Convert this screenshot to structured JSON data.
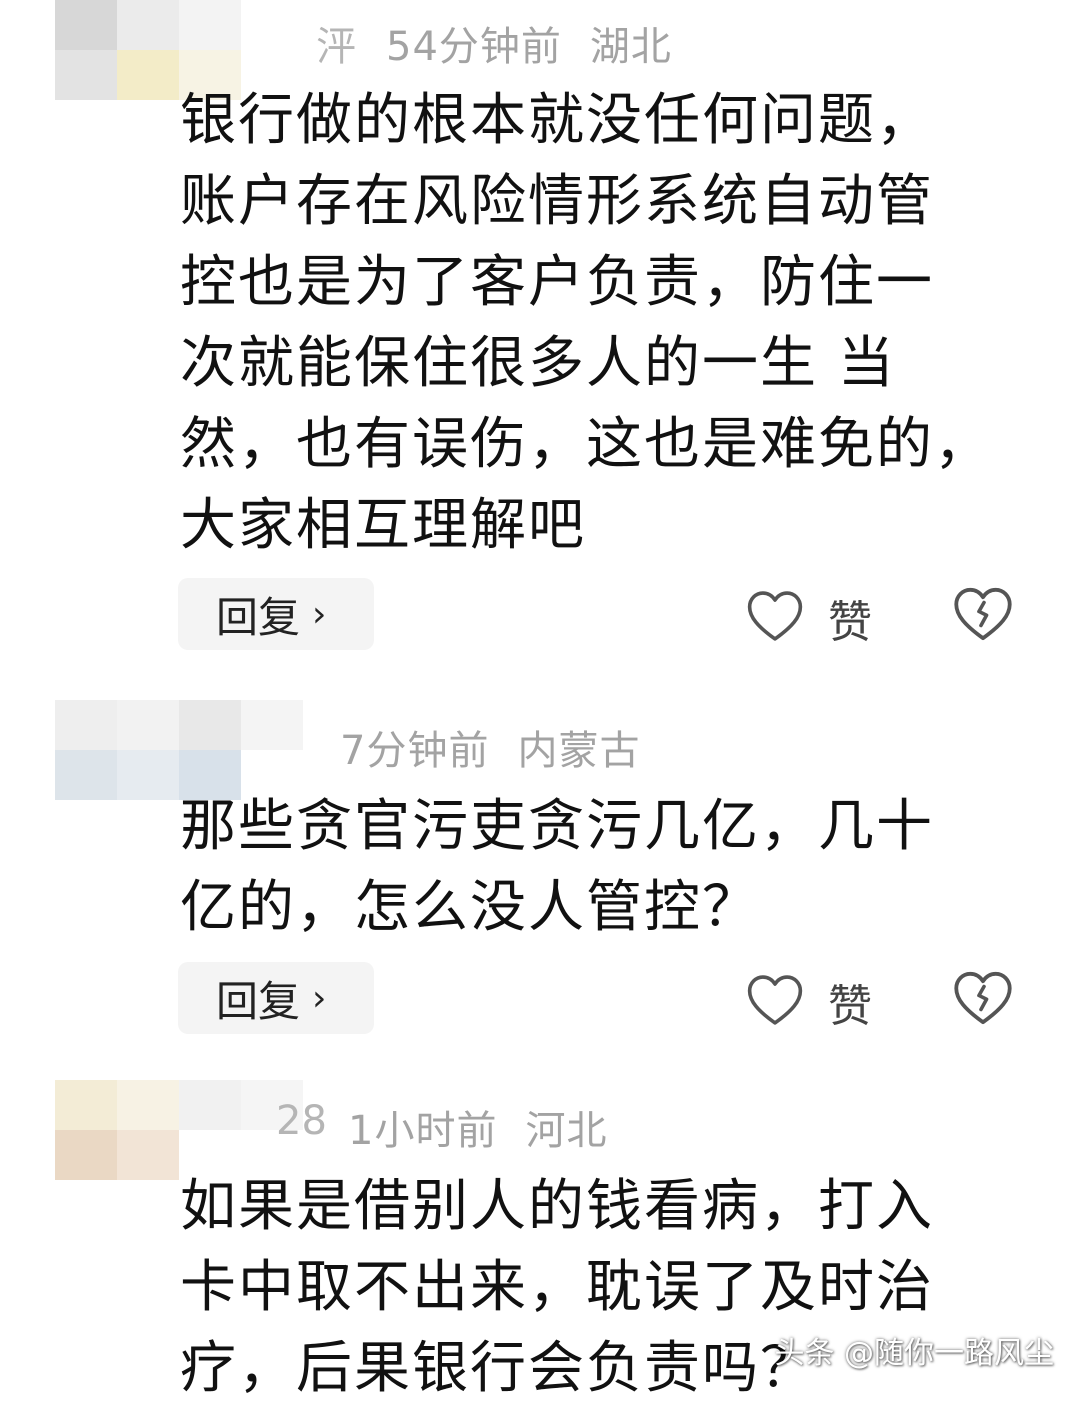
{
  "comments": [
    {
      "name_fragment": "泙",
      "time": "54分钟前",
      "location": "湖北",
      "lines": [
        "银行做的根本就没任何问题，",
        "账户存在风险情形系统自动管",
        "控也是为了客户负责，防住一",
        "次就能保住很多人的一生 当",
        "然，也有误伤，这也是难免的，",
        "大家相互理解吧"
      ],
      "reply_label": "回复",
      "like_label": "赞"
    },
    {
      "name_fragment": "",
      "time": "7分钟前",
      "location": "内蒙古",
      "lines": [
        "那些贪官污吏贪污几亿，几十",
        "亿的，怎么没人管控？"
      ],
      "reply_label": "回复",
      "like_label": "赞"
    },
    {
      "name_fragment": "28",
      "time": "1小时前",
      "location": "河北",
      "lines": [
        "如果是借别人的钱看病，打入",
        "卡中取不出来，耽误了及时治",
        "疗，后果银行会负责吗？"
      ]
    }
  ],
  "watermark": "头条 @随你一路风尘",
  "icons": {
    "like": "heart-outline-icon",
    "dislike": "broken-heart-icon",
    "reply_chevron": "chevron-right-icon"
  },
  "colors": {
    "meta_text": "#a3a3a3",
    "body_text": "#111111",
    "reply_bg": "#f4f4f4"
  }
}
